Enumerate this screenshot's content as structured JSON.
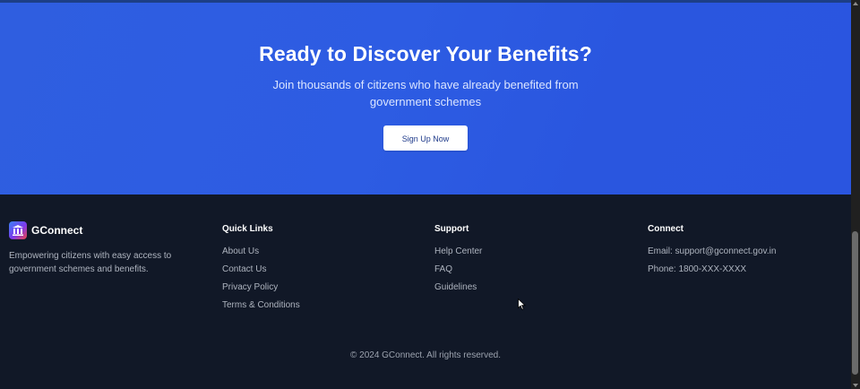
{
  "cta": {
    "title": "Ready to Discover Your Benefits?",
    "subtitle": "Join thousands of citizens who have already benefited from government schemes",
    "button_label": "Sign Up Now"
  },
  "footer": {
    "brand": {
      "name": "GConnect",
      "logo_icon": "government-building-icon",
      "description": "Empowering citizens with easy access to government schemes and benefits."
    },
    "quick_links": {
      "title": "Quick Links",
      "items": [
        "About Us",
        "Contact Us",
        "Privacy Policy",
        "Terms & Conditions"
      ]
    },
    "support": {
      "title": "Support",
      "items": [
        "Help Center",
        "FAQ",
        "Guidelines"
      ]
    },
    "connect": {
      "title": "Connect",
      "email": "Email: support@gconnect.gov.in",
      "phone": "Phone: 1800-XXX-XXXX"
    },
    "copyright": "© 2024 GConnect. All rights reserved."
  },
  "colors": {
    "cta_background": "#2d5ce3",
    "footer_background": "#111827",
    "button_text": "#1e3a8a"
  }
}
